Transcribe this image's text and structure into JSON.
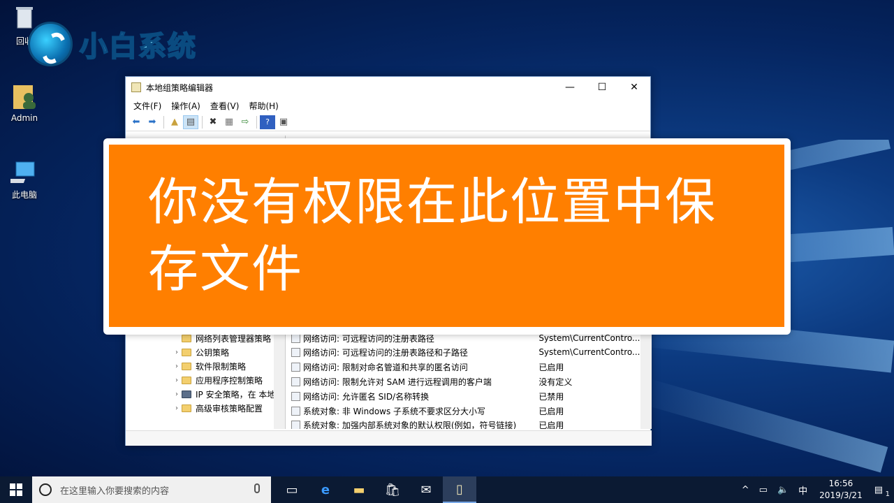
{
  "desktop": {
    "icons": [
      {
        "label": "回收",
        "icon": "recycle-bin-icon"
      },
      {
        "label": "Admin",
        "icon": "user-folder-icon"
      },
      {
        "label": "此电脑",
        "icon": "computer-icon"
      }
    ],
    "logo_text": "小白系统"
  },
  "window": {
    "title": "本地组策略编辑器",
    "menu": [
      "文件(F)",
      "操作(A)",
      "查看(V)",
      "帮助(H)"
    ],
    "tree": [
      {
        "label": "网络列表管理器策略",
        "expandable": false
      },
      {
        "label": "公钥策略",
        "expandable": true
      },
      {
        "label": "软件限制策略",
        "expandable": true
      },
      {
        "label": "应用程序控制策略",
        "expandable": true
      },
      {
        "label": "IP 安全策略，在 本地",
        "expandable": true
      },
      {
        "label": "高级审核策略配置",
        "expandable": true
      }
    ],
    "policies": [
      {
        "name": "网络访问: 可远程访问的注册表路径",
        "value": "System\\CurrentContro..."
      },
      {
        "name": "网络访问: 可远程访问的注册表路径和子路径",
        "value": "System\\CurrentContro..."
      },
      {
        "name": "网络访问: 限制对命名管道和共享的匿名访问",
        "value": "已启用"
      },
      {
        "name": "网络访问: 限制允许对 SAM 进行远程调用的客户端",
        "value": "没有定义"
      },
      {
        "name": "网络访问: 允许匿名 SID/名称转换",
        "value": "已禁用"
      },
      {
        "name": "系统对象: 非 Windows 子系统不要求区分大小写",
        "value": "已启用"
      },
      {
        "name": "系统对象: 加强内部系统对象的默认权限(例如，符号链接)",
        "value": "已启用"
      }
    ]
  },
  "banner": {
    "text": "你没有权限在此位置中保存文件",
    "color": "#ff7f00"
  },
  "taskbar": {
    "search_placeholder": "在这里输入你要搜索的内容",
    "ime": "中",
    "time": "16:56",
    "date": "2019/3/21",
    "notification_count": "1"
  }
}
